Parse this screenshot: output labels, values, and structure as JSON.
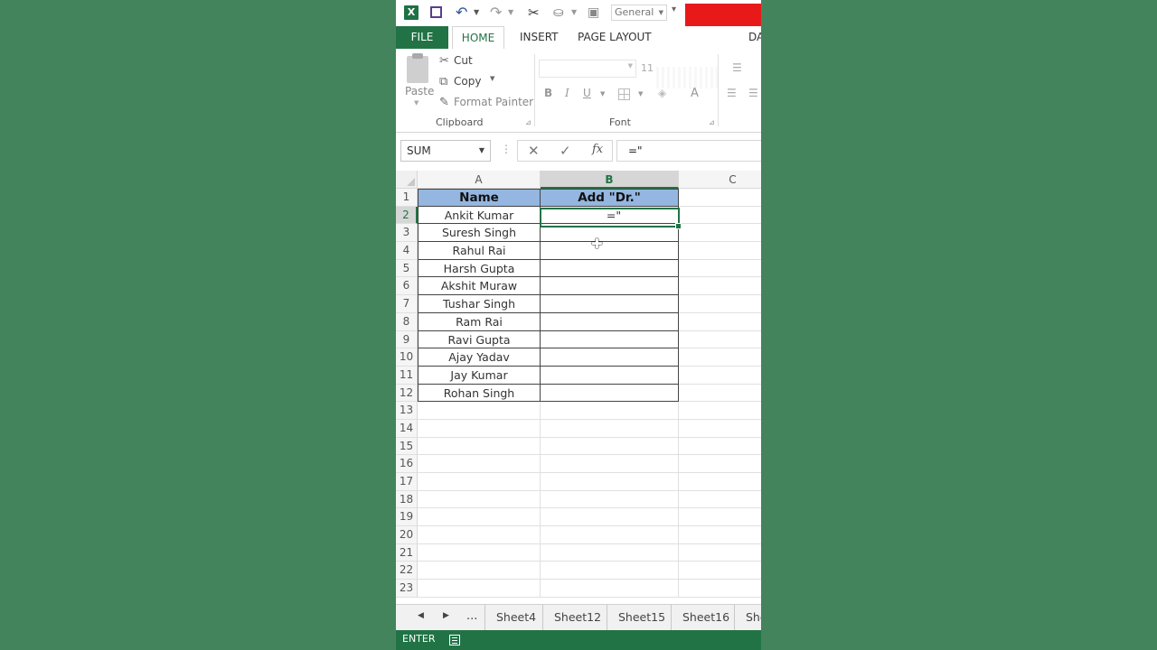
{
  "qat": {
    "app_logo": "X",
    "number_format": "General"
  },
  "tabs": [
    {
      "label": "FILE"
    },
    {
      "label": "HOME"
    },
    {
      "label": "INSERT"
    },
    {
      "label": "PAGE LAYOUT"
    },
    {
      "label": "DA"
    }
  ],
  "ribbon": {
    "paste_label": "Paste",
    "cut_label": "Cut",
    "copy_label": "Copy",
    "format_painter_label": "Format Painter",
    "clipboard_group": "Clipboard",
    "font_size": "11",
    "bold": "B",
    "italic": "I",
    "underline": "U",
    "font_color": "A",
    "font_group": "Font"
  },
  "formula_bar": {
    "name_box": "SUM",
    "fx": "fx",
    "formula": "=\""
  },
  "grid": {
    "columns": [
      "A",
      "B",
      "C"
    ],
    "active_column": "B",
    "active_row": 2,
    "rows": [
      "1",
      "2",
      "3",
      "4",
      "5",
      "6",
      "7",
      "8",
      "9",
      "10",
      "11",
      "12",
      "13",
      "14",
      "15",
      "16",
      "17",
      "18",
      "19",
      "20",
      "21",
      "22",
      "23"
    ],
    "header": {
      "a": "Name",
      "b": "Add \"Dr.\""
    },
    "names": [
      "Ankit Kumar",
      "Suresh Singh",
      "Rahul Rai",
      "Harsh Gupta",
      "Akshit Muraw",
      "Tushar Singh",
      "Ram Rai",
      "Ravi Gupta",
      "Ajay Yadav",
      "Jay Kumar",
      "Rohan Singh"
    ],
    "active_cell_value": "=\""
  },
  "sheets": {
    "more": "...",
    "tabs": [
      "Sheet4",
      "Sheet12",
      "Sheet15",
      "Sheet16",
      "She"
    ]
  },
  "status": {
    "mode": "ENTER"
  },
  "colors": {
    "background": "#44845c",
    "excel_green": "#217346",
    "header_fill": "#94b6e0",
    "red_block": "#e81919"
  }
}
